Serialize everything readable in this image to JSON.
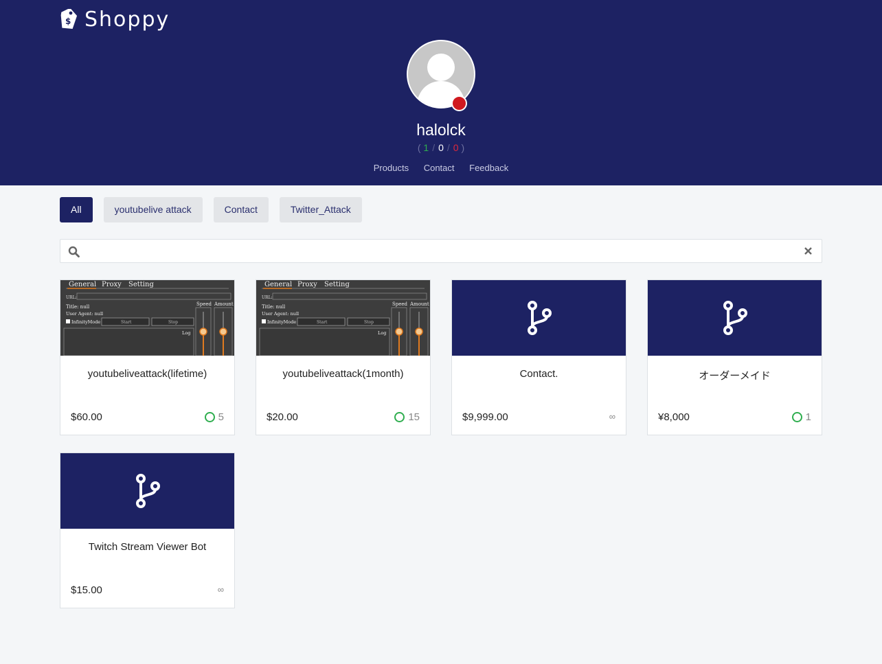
{
  "brand": {
    "name": "Shoppy"
  },
  "profile": {
    "username": "halolck",
    "rating": {
      "positive": "1",
      "neutral": "0",
      "negative": "0"
    }
  },
  "nav": [
    {
      "label": "Products"
    },
    {
      "label": "Contact"
    },
    {
      "label": "Feedback"
    }
  ],
  "filters": [
    {
      "label": "All",
      "active": true
    },
    {
      "label": "youtubelive attack",
      "active": false
    },
    {
      "label": "Contact",
      "active": false
    },
    {
      "label": "Twitter_Attack",
      "active": false
    }
  ],
  "search": {
    "value": "",
    "placeholder": ""
  },
  "screenshot_labels": {
    "tabs": [
      "General",
      "Proxy",
      "Setting"
    ],
    "url": "URL:",
    "title": "Title: null",
    "agent": "User Agent: null",
    "infinity": "InfinityMode",
    "start": "Start",
    "stop": "Stop",
    "log": "Log",
    "speed": "Speed",
    "amount": "Amount"
  },
  "products": [
    {
      "title": "youtubeliveattack(lifetime)",
      "price": "$60.00",
      "stock": "5",
      "thumb": "screenshot",
      "icon": ""
    },
    {
      "title": "youtubeliveattack(1month)",
      "price": "$20.00",
      "stock": "15",
      "thumb": "screenshot",
      "icon": ""
    },
    {
      "title": "Contact.",
      "price": "$9,999.00",
      "stock": "∞",
      "thumb": "icon",
      "icon": "code-branch-icon"
    },
    {
      "title": "オーダーメイド",
      "price": "¥8,000",
      "stock": "1",
      "thumb": "icon",
      "icon": "code-branch-icon"
    },
    {
      "title": "Twitch Stream Viewer Bot",
      "price": "$15.00",
      "stock": "∞",
      "thumb": "icon",
      "icon": "code-branch-icon"
    }
  ],
  "colors": {
    "header": "#1d2263",
    "positive": "#2fae4f",
    "negative": "#e0283a",
    "status": "#d0191f"
  }
}
